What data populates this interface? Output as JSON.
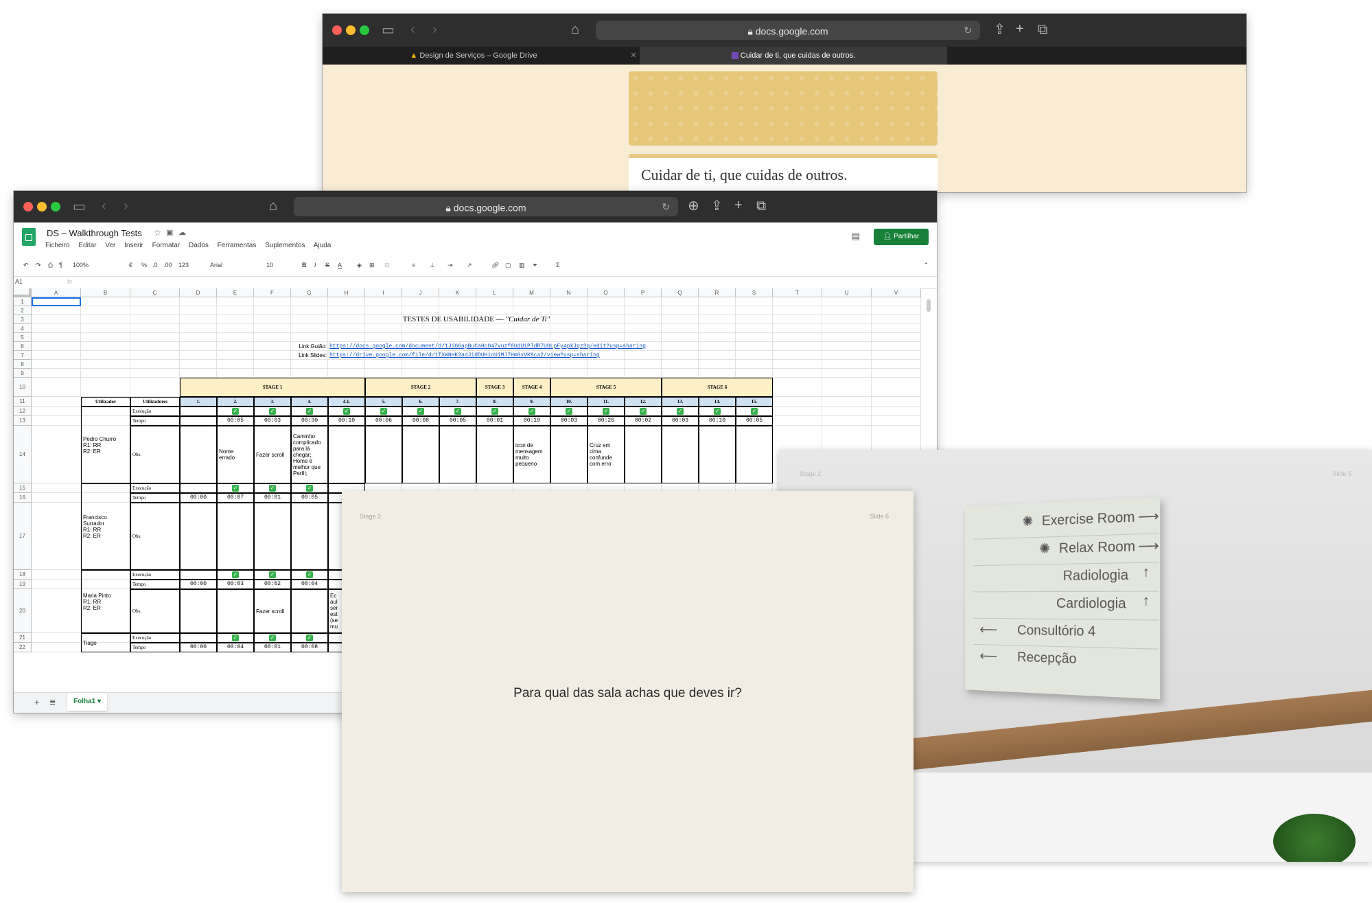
{
  "back_browser": {
    "url": "docs.google.com",
    "tabs": [
      {
        "label": "Design de Serviços – Google Drive",
        "icon": "google-drive-icon"
      },
      {
        "label": "Cuidar de ti, que cuidas de outros.",
        "icon": "google-forms-icon"
      }
    ],
    "doc_title": "Cuidar de ti, que cuidas de outros.",
    "colors": {
      "page": "#f8ecd5",
      "banner": "#e6c779"
    }
  },
  "front_browser": {
    "url": "docs.google.com",
    "doc_name": "DS – Walkthrough Tests",
    "menu": [
      "Ficheiro",
      "Editar",
      "Ver",
      "Inserir",
      "Formatar",
      "Dados",
      "Ferramentas",
      "Suplementos",
      "Ajuda"
    ],
    "share_label": "Partilhar",
    "toolbar": {
      "zoom": "100%",
      "currency": "€",
      "percent": "%",
      "dec1": ".0",
      "dec2": ".00",
      "format": "123",
      "font": "Arial",
      "size": "10"
    },
    "cell_ref": "A1",
    "fx": "fx",
    "columns": [
      "A",
      "B",
      "C",
      "D",
      "E",
      "F",
      "G",
      "H",
      "I",
      "J",
      "K",
      "L",
      "M",
      "N",
      "O",
      "P",
      "Q",
      "R",
      "S",
      "T",
      "U",
      "V"
    ],
    "rows": [
      "1",
      "2",
      "3",
      "4",
      "5",
      "6",
      "7",
      "8",
      "9",
      "10",
      "11",
      "12",
      "13",
      "14",
      "15",
      "16",
      "17",
      "18",
      "19",
      "20",
      "21",
      "22"
    ],
    "sheet_title_main": "TESTES DE USABILIDADE — ",
    "sheet_title_em": "\"Cuidar de Ti\"",
    "link_guiao_label": "Link Guião:",
    "link_guiao": "https://docs.google.com/document/d/1JiG6apBuCaHo047vuzf6UdUiPldR7UGLpFy4pXJqz3q/edit?usp=sharing",
    "link_slides_label": "Link Slides:",
    "link_slides": "https://drive.google.com/file/d/1TXWNHK3adJidDUHioUiMJ7HmGxVK9ca2/view?usp=sharing",
    "stages": [
      "STAGE 1",
      "STAGE 2",
      "STAGE 3",
      "STAGE 4",
      "STAGE 5",
      "STAGE 6"
    ],
    "hdr_utilizador": "Utilizador",
    "hdr_utilizadores": "Utilizadores",
    "step_numbers": [
      "1.",
      "2.",
      "3.",
      "4.",
      "4.1.",
      "5.",
      "6.",
      "7.",
      "8.",
      "9.",
      "10.",
      "11.",
      "12.",
      "13.",
      "14.",
      "15."
    ],
    "labels": {
      "execucao": "Execução",
      "tempo": "Tempo",
      "obs": "Obs."
    },
    "users": [
      {
        "name": "Pedro Churro\nR1: RR\nR2: ER",
        "times": [
          "",
          "00:05",
          "00:03",
          "00:30",
          "00:10",
          "00:06",
          "00:08",
          "00:05",
          "00:01",
          "00:19",
          "00:03",
          "00:26",
          "00:02",
          "00:03",
          "00:10",
          "00:05"
        ],
        "checks": [
          false,
          true,
          true,
          true,
          true,
          true,
          true,
          true,
          true,
          true,
          true,
          true,
          true,
          true,
          true,
          true
        ],
        "obs": {
          "E": "Nome\nerrado",
          "F": "Fazer scroll",
          "G": "Caminho\ncomplicado\npara lá\nchegar;\nHome é\nmelhor que\nPerfil;",
          "M": "icon de\nmensagem\nmuito\npequeno",
          "O": "Cruz em\ncima\nconfunde\ncom erro"
        }
      },
      {
        "name": "Francisco\nSurrador\nR1: RR\nR2: ER",
        "times": [
          "00:00",
          "00:07",
          "00:01",
          "00:05"
        ],
        "checks": [
          false,
          true,
          true,
          true
        ],
        "obs": {}
      },
      {
        "name": "Maria Pinto\nR1: RR\nR2: ER",
        "times": [
          "00:00",
          "00:03",
          "00:02",
          "00:04"
        ],
        "checks": [
          false,
          true,
          true,
          true
        ],
        "obs": {
          "F": "Fazer scroll",
          "H": "Ec\naul\nser\nest\n(se\nmu"
        }
      },
      {
        "name": "Tiago",
        "times": [
          "00:00",
          "00:04",
          "00:01",
          "00:08"
        ],
        "checks": [
          false,
          true,
          true,
          true
        ],
        "obs": {}
      }
    ],
    "sheet_tab": "Folha1"
  },
  "slide6": {
    "stage_label": "Stage 2",
    "slide_label": "Slide 6",
    "question": "Para qual das sala achas que deves ir?"
  },
  "slide5": {
    "stage_label": "Stage 2",
    "slide_label": "Slide 5",
    "sign": [
      {
        "label": "Exercise Room",
        "arrow": "right",
        "icon": "wheel-icon"
      },
      {
        "label": "Relax Room",
        "arrow": "right",
        "icon": "wheel-icon"
      },
      {
        "label": "Radiologia",
        "arrow": "up"
      },
      {
        "label": "Cardiologia",
        "arrow": "up"
      },
      {
        "label": "Consultório 4",
        "arrow": "left"
      },
      {
        "label": "Recepção",
        "arrow": "left"
      }
    ]
  }
}
